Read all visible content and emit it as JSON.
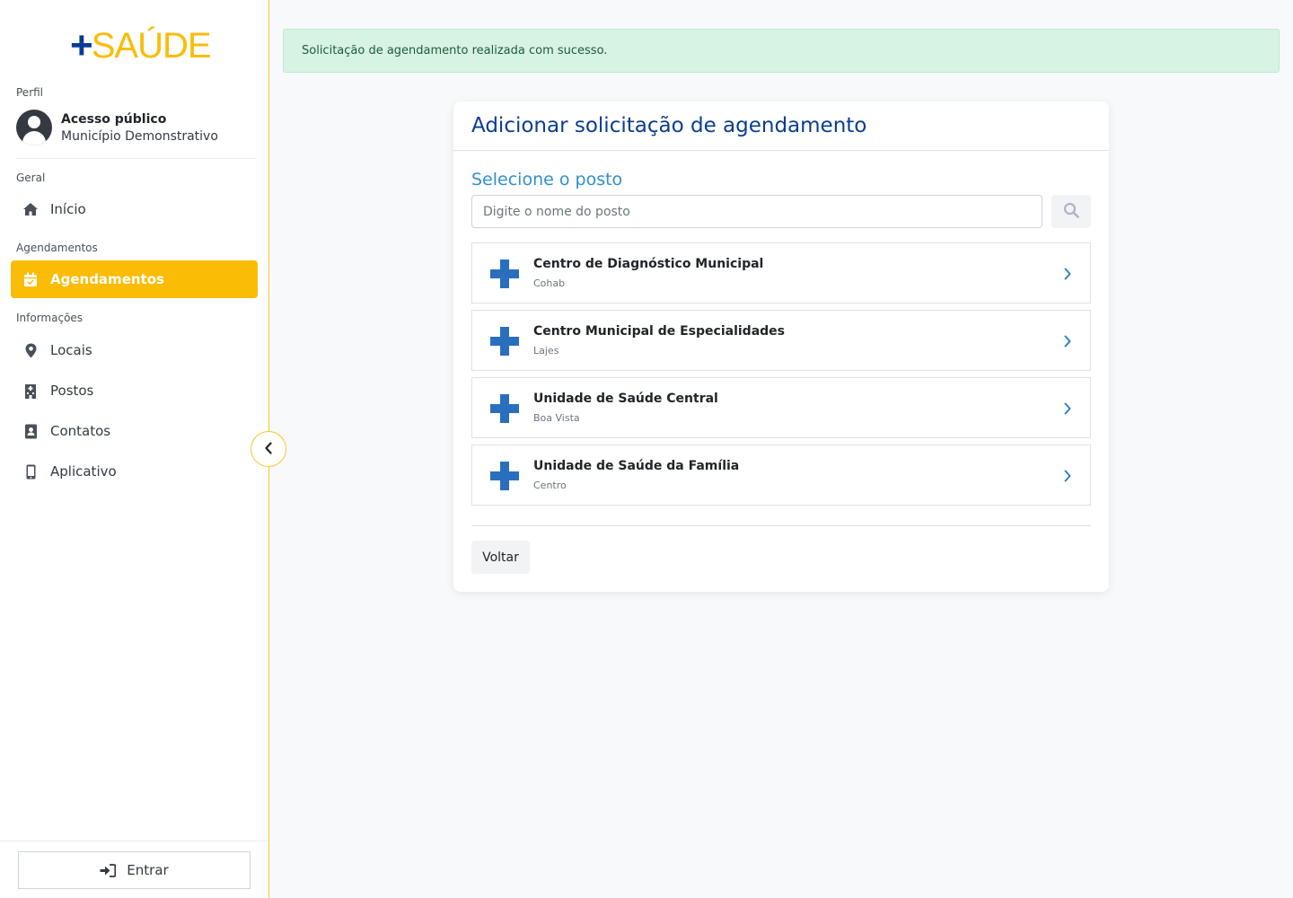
{
  "brand": {
    "plus": "+",
    "name": "SAÚDE"
  },
  "sidebar": {
    "profile_label": "Perfil",
    "profile": {
      "name": "Acesso público",
      "city": "Município Demonstrativo"
    },
    "sections": [
      {
        "label": "Geral"
      },
      {
        "label": "Agendamentos"
      },
      {
        "label": "Informações"
      }
    ],
    "items": [
      {
        "label": "Início",
        "icon": "home-icon"
      },
      {
        "label": "Agendamentos",
        "icon": "calendar-check-icon",
        "active": true
      },
      {
        "label": "Locais",
        "icon": "map-marker-icon"
      },
      {
        "label": "Postos",
        "icon": "hospital-building-icon"
      },
      {
        "label": "Contatos",
        "icon": "address-book-icon"
      },
      {
        "label": "Aplicativo",
        "icon": "mobile-phone-icon"
      }
    ],
    "login_label": "Entrar"
  },
  "alert": {
    "message": "Solicitação de agendamento realizada com sucesso."
  },
  "card": {
    "title": "Adicionar solicitação de agendamento",
    "subtitle": "Selecione o posto",
    "search_placeholder": "Digite o nome do posto",
    "postos": [
      {
        "name": "Centro de Diagnóstico Municipal",
        "neighborhood": "Cohab"
      },
      {
        "name": "Centro Municipal de Especialidades",
        "neighborhood": "Lajes"
      },
      {
        "name": "Unidade de Saúde Central",
        "neighborhood": "Boa Vista"
      },
      {
        "name": "Unidade de Saúde da Família",
        "neighborhood": "Centro"
      }
    ],
    "back_label": "Voltar"
  },
  "colors": {
    "accent": "#fbbc05",
    "brand_blue": "#0a3d91",
    "cross_blue": "#2a6fbd",
    "link_blue": "#2f8fcf",
    "success_bg": "#d7f3e3"
  }
}
